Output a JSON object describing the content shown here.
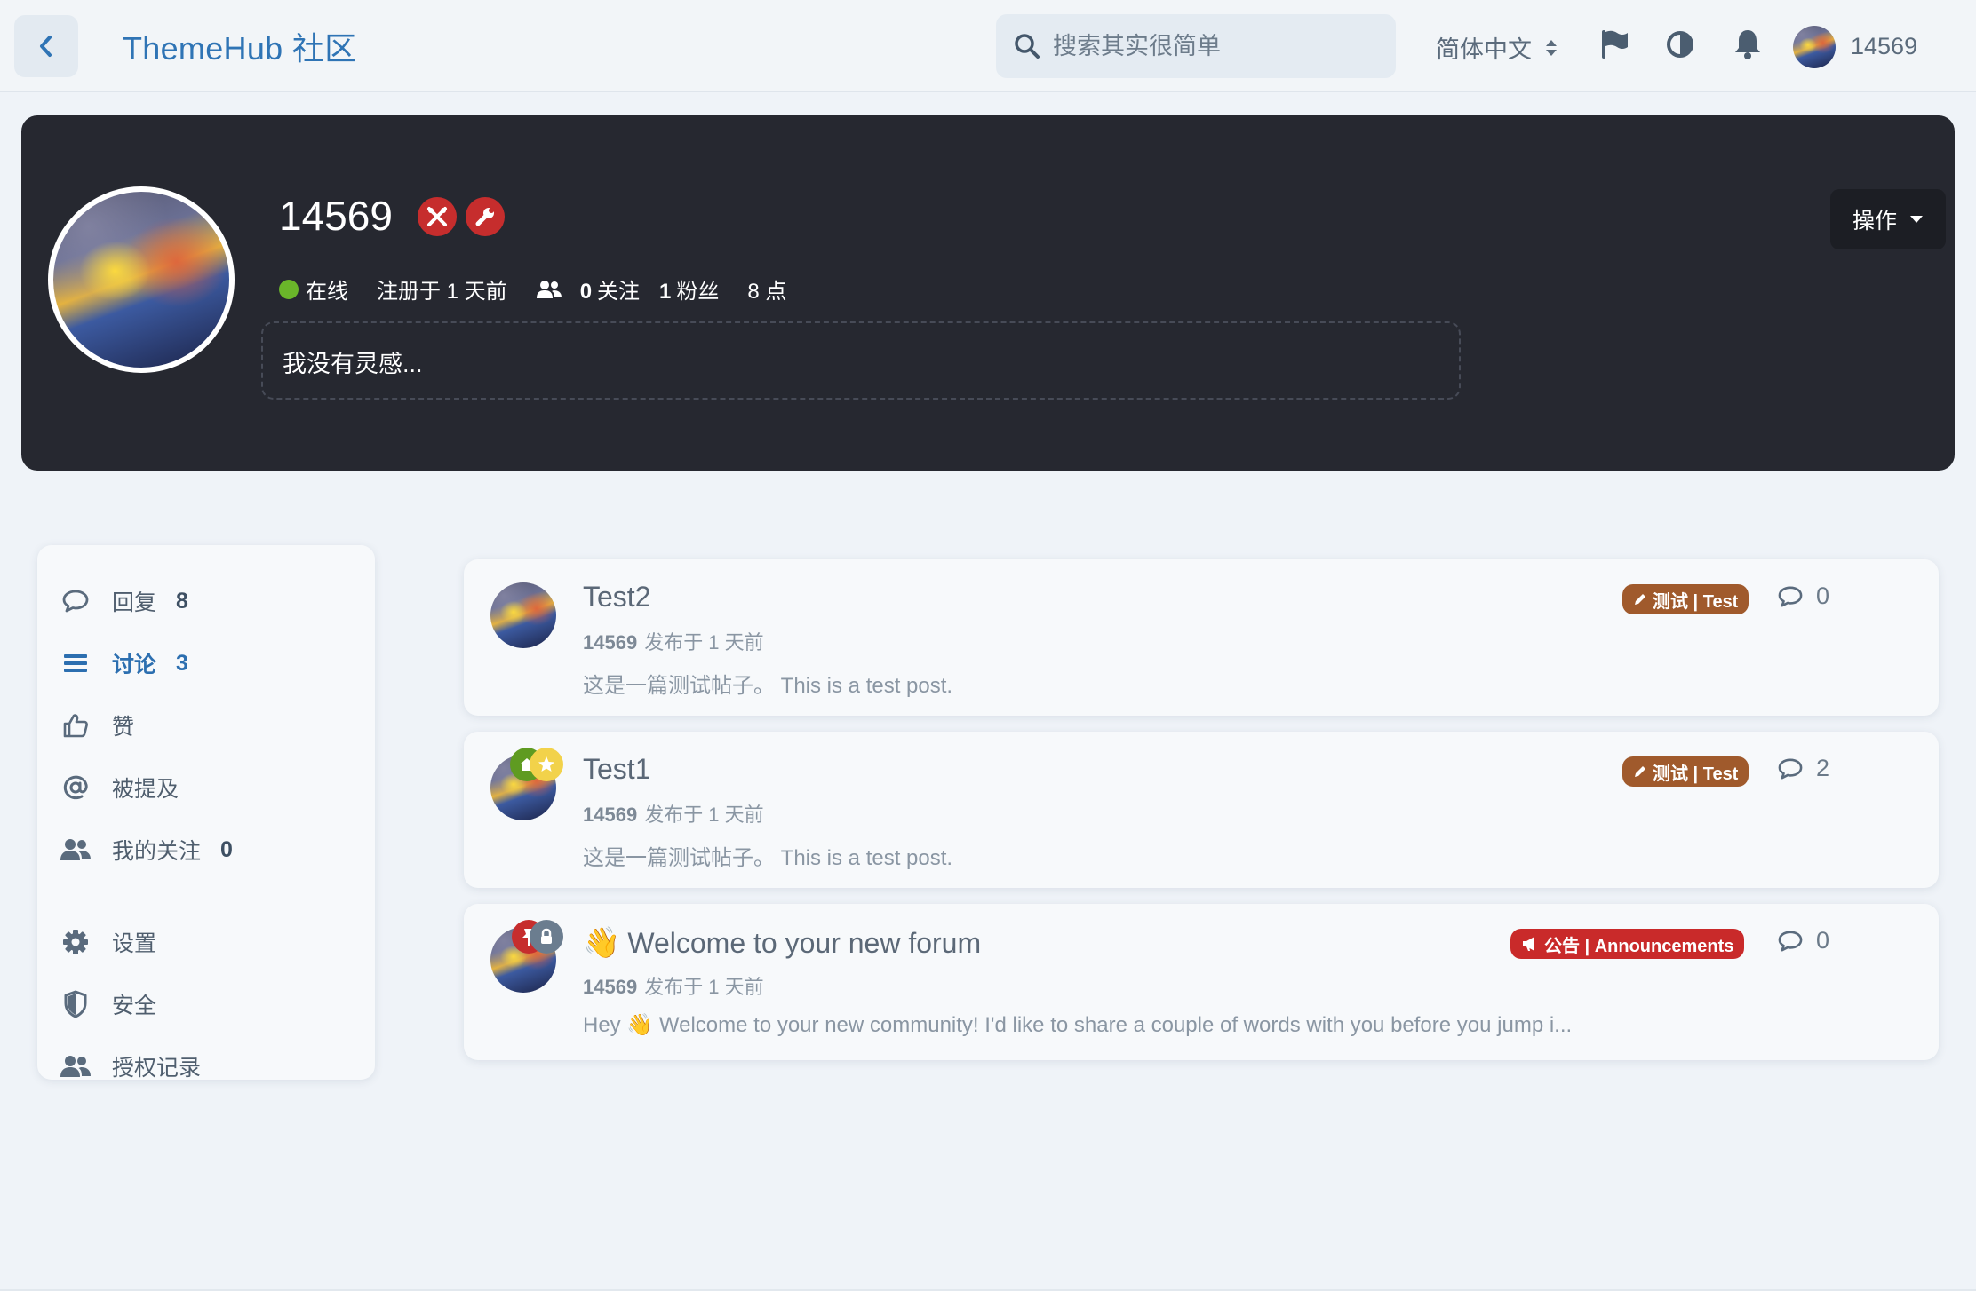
{
  "header": {
    "title": "ThemeHub 社区",
    "search_placeholder": "搜索其实很简单",
    "language": "简体中文",
    "username": "14569"
  },
  "profile": {
    "name": "14569",
    "status": "在线",
    "registered": "注册于 1 天前",
    "following_count": "0",
    "following_label": "关注",
    "followers_count": "1",
    "followers_label": "粉丝",
    "points": "8 点",
    "bio": "我没有灵感...",
    "actions_label": "操作"
  },
  "sidebar": {
    "items": [
      {
        "label": "回复",
        "count": "8",
        "icon": "comment-icon"
      },
      {
        "label": "讨论",
        "count": "3",
        "icon": "list-icon",
        "active": true
      },
      {
        "label": "赞",
        "count": "",
        "icon": "thumbs-up-icon"
      },
      {
        "label": "被提及",
        "count": "",
        "icon": "at-icon"
      },
      {
        "label": "我的关注",
        "count": "0",
        "icon": "users-icon"
      },
      {
        "label": "设置",
        "count": "",
        "icon": "gear-icon"
      },
      {
        "label": "安全",
        "count": "",
        "icon": "shield-icon"
      },
      {
        "label": "授权记录",
        "count": "",
        "icon": "users-icon"
      }
    ]
  },
  "discussions": [
    {
      "title": "Test2",
      "author": "14569",
      "meta": "发布于 1 天前",
      "excerpt": "这是一篇测试帖子。 This is a test post.",
      "tag": "测试 | Test",
      "tag_color": "#a05a2c",
      "replies": "0"
    },
    {
      "title": "Test1",
      "author": "14569",
      "meta": "发布于 1 天前",
      "excerpt": "这是一篇测试帖子。 This is a test post.",
      "tag": "测试 | Test",
      "tag_color": "#a05a2c",
      "replies": "2"
    },
    {
      "title": "Welcome to your new forum",
      "author": "14569",
      "meta": "发布于 1 天前",
      "excerpt": "Hey 👋 Welcome to your new community! I'd like to share a couple of words with you before you jump i...",
      "tag": "公告 | Announcements",
      "tag_color": "#c92a2a",
      "replies": "0"
    }
  ],
  "colors": {
    "accent": "#2f74b5",
    "hero_bg": "#262830",
    "online": "#6ab62a"
  }
}
